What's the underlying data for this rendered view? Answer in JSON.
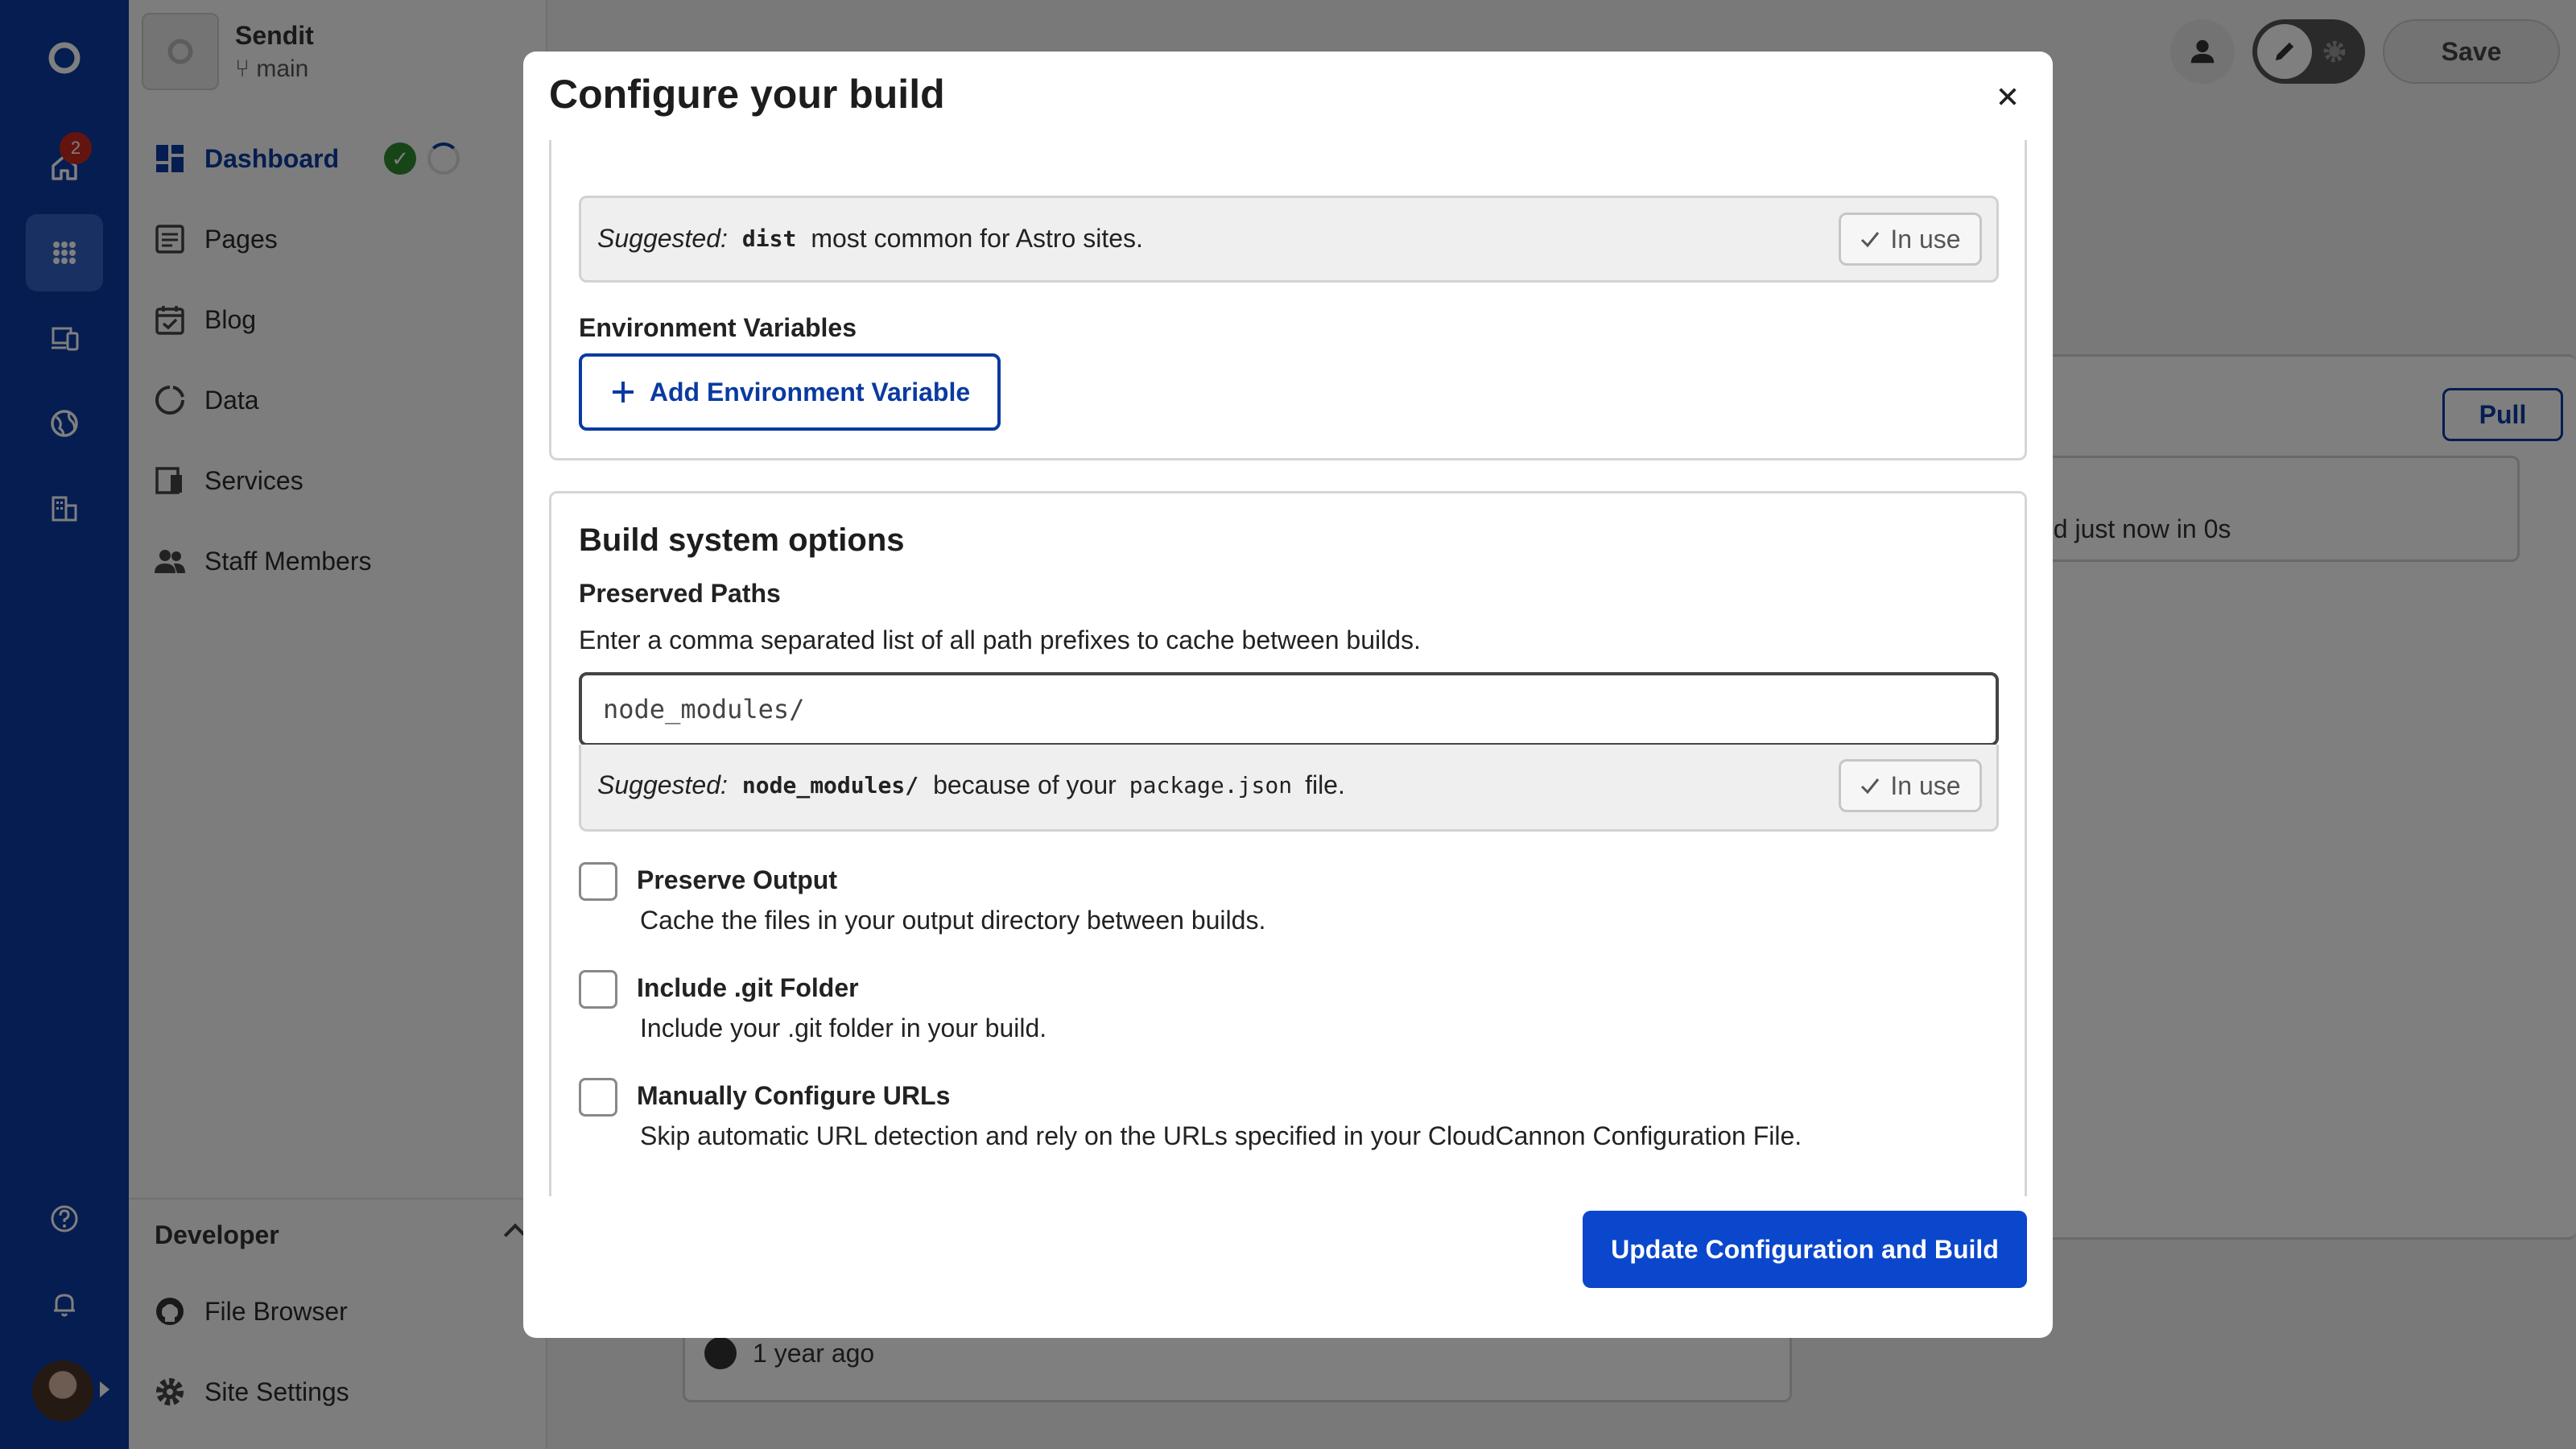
{
  "site": {
    "name": "Sendit",
    "branch": "main"
  },
  "rail": {
    "notification_count": "2"
  },
  "sidebar": {
    "items": [
      {
        "label": "Dashboard"
      },
      {
        "label": "Pages"
      },
      {
        "label": "Blog"
      },
      {
        "label": "Data"
      },
      {
        "label": "Services"
      },
      {
        "label": "Staff Members"
      }
    ],
    "developer": {
      "title": "Developer",
      "items": [
        {
          "label": "File Browser"
        },
        {
          "label": "Site Settings"
        }
      ]
    }
  },
  "topbar": {
    "save_label": "Save"
  },
  "background": {
    "pull_label": "Pull",
    "status_text": "ed just now in 0s",
    "time_text": "1 year ago"
  },
  "modal": {
    "title": "Configure your build",
    "output_suggestion": {
      "label": "Suggested:",
      "code": "dist",
      "text": "most common for Astro sites.",
      "in_use_label": "In use"
    },
    "env": {
      "label": "Environment Variables",
      "add_button": "Add Environment Variable"
    },
    "build_system": {
      "title": "Build system options",
      "preserved_paths_label": "Preserved Paths",
      "preserved_paths_desc": "Enter a comma separated list of all path prefixes to cache between builds.",
      "preserved_paths_value": "node_modules/",
      "suggestion": {
        "label": "Suggested:",
        "code": "node_modules/",
        "text_before": "because of your",
        "code2": "package.json",
        "text_after": "file.",
        "in_use_label": "In use"
      },
      "options": [
        {
          "title": "Preserve Output",
          "desc": "Cache the files in your output directory between builds."
        },
        {
          "title": "Include .git Folder",
          "desc": "Include your .git folder in your build."
        },
        {
          "title": "Manually Configure URLs",
          "desc": "Skip automatic URL detection and rely on the URLs specified in your CloudCannon Configuration File."
        }
      ]
    },
    "submit_button": "Update Configuration and Build"
  }
}
